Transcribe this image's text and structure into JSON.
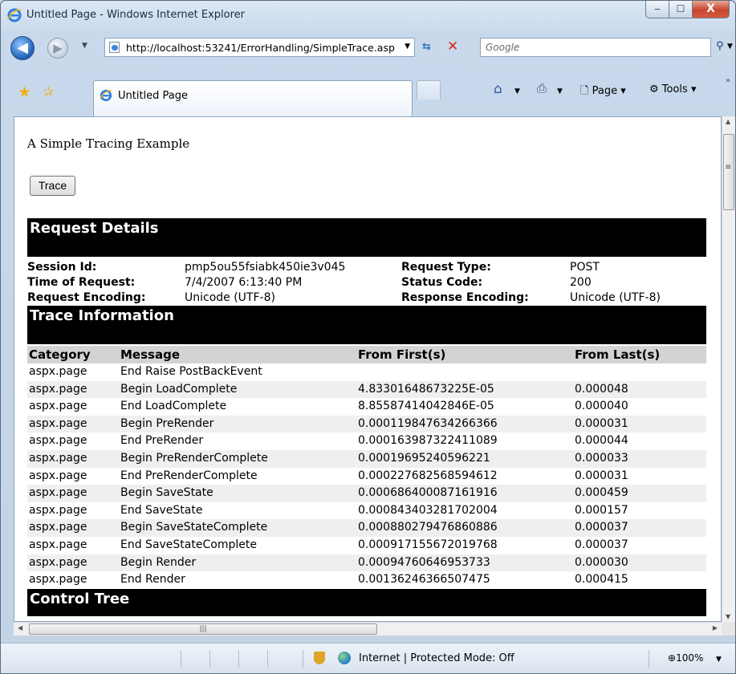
{
  "window": {
    "title": "Untitled Page - Windows Internet Explorer",
    "min_glyph": "‒",
    "max_glyph": "☐",
    "close_glyph": "X"
  },
  "nav": {
    "back_glyph": "◀",
    "forward_glyph": "▶",
    "address": "http://localhost:53241/ErrorHandling/SimpleTrace.aspx",
    "search_placeholder": "Google"
  },
  "tabs": {
    "active_label": "Untitled Page"
  },
  "toolbar": {
    "page_label": "Page",
    "tools_label": "Tools",
    "more": "»"
  },
  "page": {
    "heading": "A Simple Tracing Example",
    "trace_button": "Trace",
    "request_details": {
      "title": "Request Details",
      "rows": [
        {
          "k1": "Session Id:",
          "v1": "pmp5ou55fsiabk450ie3v045",
          "k2": "Request Type:",
          "v2": "POST"
        },
        {
          "k1": "Time of Request:",
          "v1": "7/4/2007 6:13:40 PM",
          "k2": "Status Code:",
          "v2": "200"
        },
        {
          "k1": "Request Encoding:",
          "v1": "Unicode (UTF-8)",
          "k2": "Response Encoding:",
          "v2": "Unicode (UTF-8)"
        }
      ]
    },
    "trace_info": {
      "title": "Trace Information",
      "headers": [
        "Category",
        "Message",
        "From First(s)",
        "From Last(s)"
      ],
      "rows": [
        [
          "aspx.page",
          "End Raise PostBackEvent",
          "",
          ""
        ],
        [
          "aspx.page",
          "Begin LoadComplete",
          "4.83301648673225E-05",
          "0.000048"
        ],
        [
          "aspx.page",
          "End LoadComplete",
          "8.85587414042846E-05",
          "0.000040"
        ],
        [
          "aspx.page",
          "Begin PreRender",
          "0.000119847634266366",
          "0.000031"
        ],
        [
          "aspx.page",
          "End PreRender",
          "0.000163987322411089",
          "0.000044"
        ],
        [
          "aspx.page",
          "Begin PreRenderComplete",
          "0.00019695240596221",
          "0.000033"
        ],
        [
          "aspx.page",
          "End PreRenderComplete",
          "0.000227682568594612",
          "0.000031"
        ],
        [
          "aspx.page",
          "Begin SaveState",
          "0.000686400087161916",
          "0.000459"
        ],
        [
          "aspx.page",
          "End SaveState",
          "0.000843403281702004",
          "0.000157"
        ],
        [
          "aspx.page",
          "Begin SaveStateComplete",
          "0.000880279476860886",
          "0.000037"
        ],
        [
          "aspx.page",
          "End SaveStateComplete",
          "0.000917155672019768",
          "0.000037"
        ],
        [
          "aspx.page",
          "Begin Render",
          "0.00094760646953733",
          "0.000030"
        ],
        [
          "aspx.page",
          "End Render",
          "0.00136246366507475",
          "0.000415"
        ]
      ]
    },
    "control_tree": {
      "title": "Control Tree"
    }
  },
  "statusbar": {
    "zone": "Internet | Protected Mode: Off",
    "zoom": "100%"
  },
  "colors": {
    "header_bar": "#000000",
    "column_header": "#d3d3d3",
    "alt_row": "#efefef"
  }
}
